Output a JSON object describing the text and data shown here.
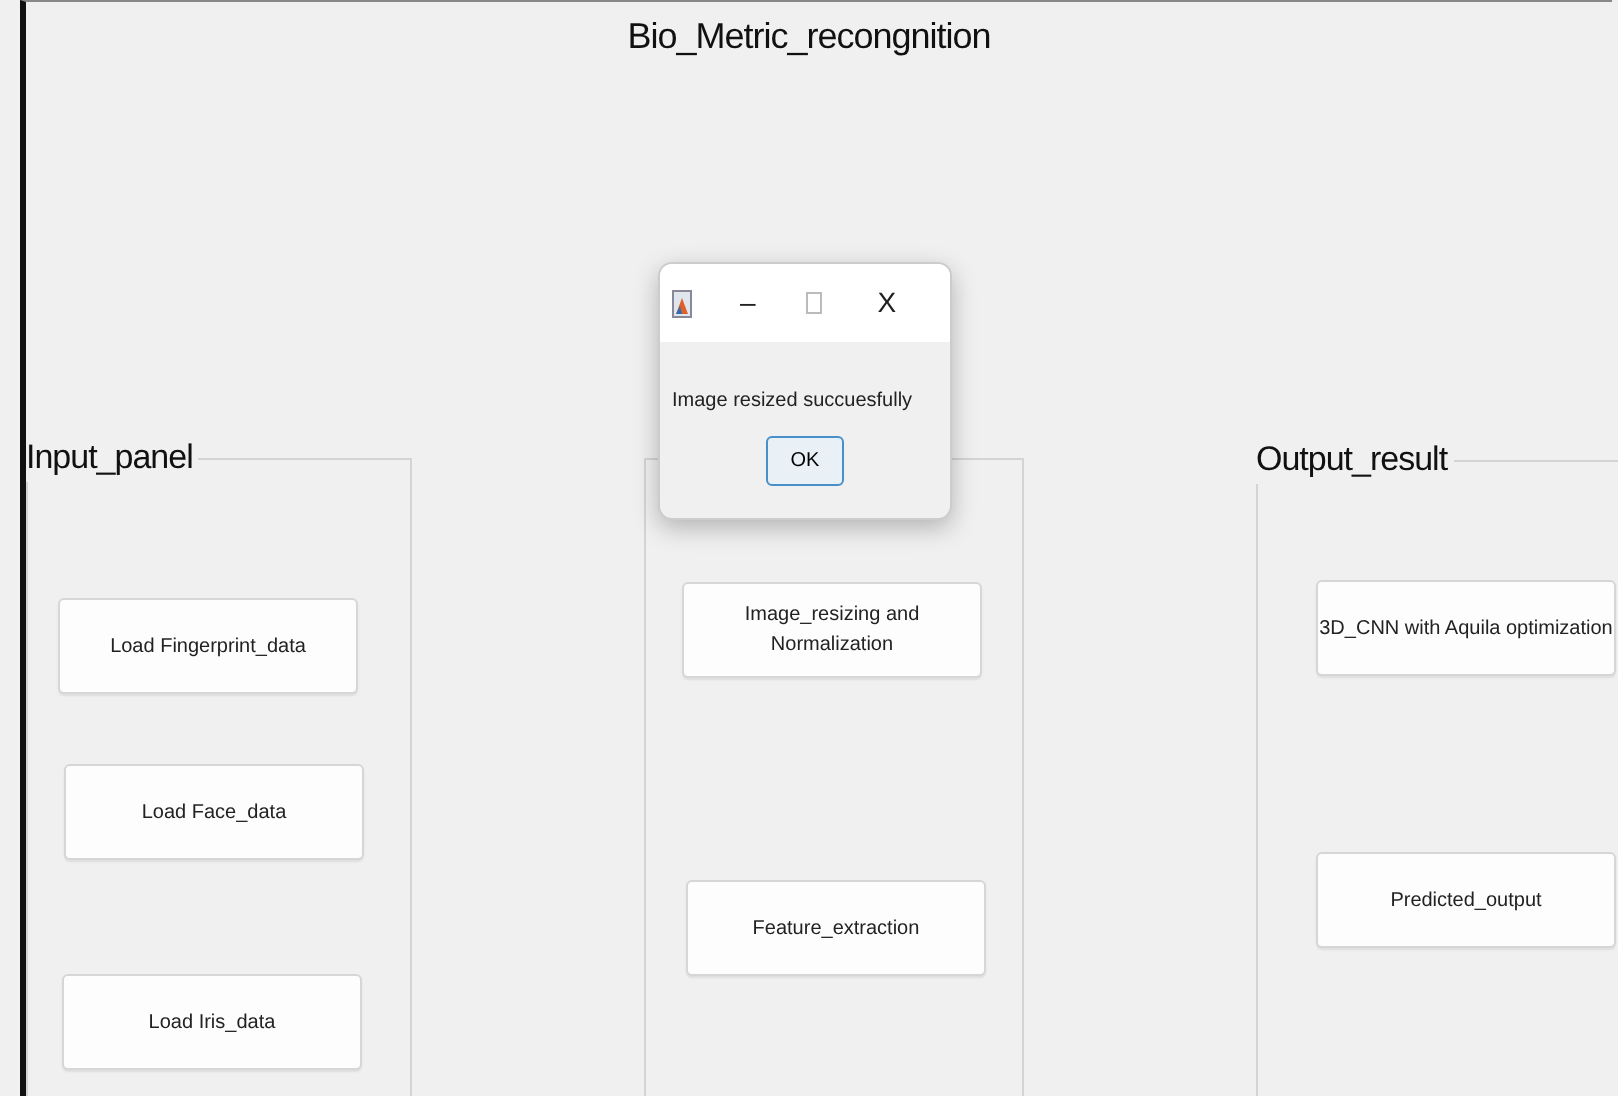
{
  "window": {
    "title": "Bio_Metric_recongnition"
  },
  "panels": [
    {
      "title": "Input_panel",
      "buttons": [
        "Load Fingerprint_data",
        "Load Face_data",
        "Load Iris_data"
      ]
    },
    {
      "buttons": [
        "Image_resizing and Normalization",
        "Feature_extraction"
      ]
    },
    {
      "title": "Output_result",
      "buttons": [
        "3D_CNN with Aquila optimization",
        "Predicted_output"
      ]
    }
  ],
  "dialog": {
    "minimize": "–",
    "close": "X",
    "message": "Image resized succuesfully",
    "ok_button": "OK"
  }
}
